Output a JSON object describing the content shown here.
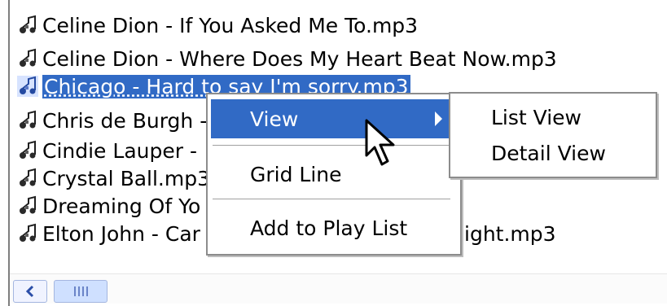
{
  "files": [
    {
      "label": "Celine Dion - If You Asked Me To.mp3",
      "selected": false
    },
    {
      "label": "Celine Dion - Where Does My Heart Beat Now.mp3",
      "selected": false
    },
    {
      "label": "Chicago - Hard to say I'm sorry.mp3",
      "selected": true
    },
    {
      "label": "Chris de Burgh - ",
      "selected": false
    },
    {
      "label": "Cindie Lauper - ",
      "selected": false
    },
    {
      "label": "Crystal Ball.mp3",
      "selected": false
    },
    {
      "label": "Dreaming Of Yo",
      "selected": false
    },
    {
      "label": "Elton John - Car",
      "tail": "ight.mp3",
      "selected": false
    }
  ],
  "context_menu": {
    "view": "View",
    "grid_line": "Grid Line",
    "add_to_play_list": "Add to Play List"
  },
  "submenu": {
    "list_view": "List View",
    "detail_view": "Detail View"
  },
  "colors": {
    "selection": "#316ac5",
    "menu_border": "#8c8c8c"
  },
  "icons": {
    "file": "music-file-icon",
    "submenu_arrow": "submenu-arrow-icon",
    "scroll_left": "scroll-left-arrow-icon",
    "cursor": "mouse-pointer-icon"
  }
}
